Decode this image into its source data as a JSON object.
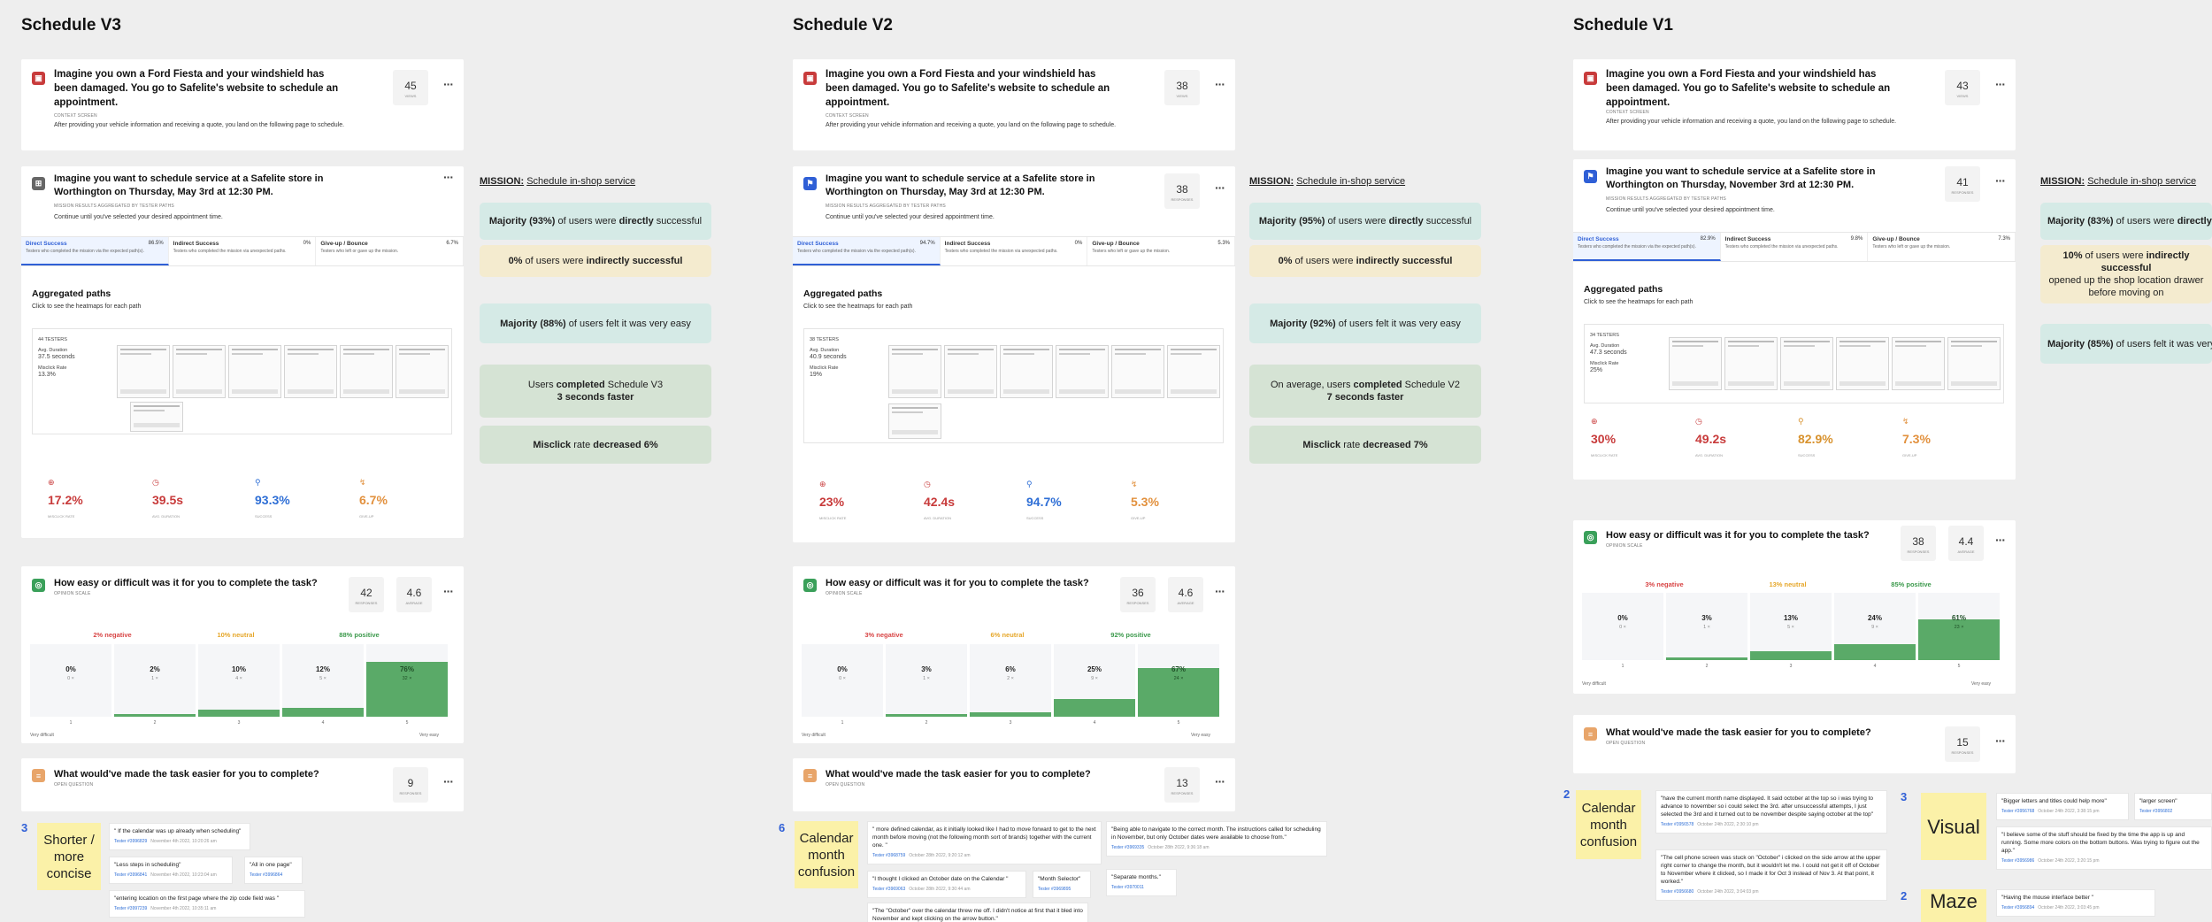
{
  "columns": [
    {
      "title": "Schedule V3",
      "context": {
        "title": "Imagine you own a Ford Fiesta and your windshield has been damaged. You go to Safelite's website to schedule an appointment.",
        "type": "CONTEXT SCREEN",
        "desc": "After providing your vehicle information and receiving a quote, you land on the following page to schedule.",
        "count": "45",
        "count_unit": "Views"
      },
      "mission": {
        "title": "Imagine you want to schedule service at a Safelite store in Worthington on Thursday, May 3rd at 12:30 PM.",
        "sub": "MISSION RESULTS AGGREGATED BY TESTER PATHS",
        "desc": "Continue until you've selected your desired appointment time.",
        "tabs": [
          {
            "label": "Direct Success",
            "pct": "86.5%",
            "desc": "Testers who completed the mission via the expected path(s).",
            "pct2": "40.5"
          },
          {
            "label": "Indirect Success",
            "pct": "0%",
            "desc": "Testers who completed the mission via unexpected paths.",
            "pct2": "0%"
          },
          {
            "label": "Give-up / Bounce",
            "pct": "6.7%",
            "desc": "Testers who left or gave up the mission.",
            "pct2": "3%"
          }
        ],
        "agg_title": "Aggregated paths",
        "agg_sub": "Click to see the heatmaps for each path",
        "stats": [
          "44 TESTERS",
          "Avg. Duration",
          "37.5 seconds",
          "Misclick Rate",
          "13.3%"
        ],
        "metrics": [
          {
            "icon": "⊕",
            "value": "17.2%",
            "label": "Misclick rate",
            "cls": "mc-red"
          },
          {
            "icon": "◷",
            "value": "39.5s",
            "label": "Avg. duration",
            "cls": "mc-red"
          },
          {
            "icon": "⚲",
            "value": "93.3%",
            "label": "Success",
            "cls": "mc-blue"
          },
          {
            "icon": "↯",
            "value": "6.7%",
            "label": "Give-up",
            "cls": "mc-peach"
          }
        ]
      },
      "difficulty": {
        "title": "How easy or difficult was it for you to complete the task?",
        "sub": "OPINION SCALE",
        "count": "42",
        "count_unit": "Responses",
        "avg": "4.6",
        "avg_unit": "Average",
        "neg": "2% negative",
        "neu": "10% neutral",
        "pos": "88% positive",
        "bars": [
          {
            "pct": "0%",
            "n": "0 ×",
            "fill": 0
          },
          {
            "pct": "2%",
            "n": "1 ×",
            "fill": 2
          },
          {
            "pct": "10%",
            "n": "4 ×",
            "fill": 10
          },
          {
            "pct": "12%",
            "n": "5 ×",
            "fill": 12
          },
          {
            "pct": "76%",
            "n": "32 ×",
            "fill": 76
          }
        ],
        "ticks": [
          "1",
          "2",
          "3",
          "4",
          "5"
        ],
        "axis_left": "Very difficult",
        "axis_right": "Very easy"
      },
      "easier": {
        "title": "What would've made the task easier for you to complete?",
        "sub": "OPEN QUESTION",
        "count": "9",
        "count_unit": "Responses"
      }
    },
    {
      "title": "Schedule V2",
      "context": {
        "title": "Imagine you own a Ford Fiesta and your windshield has been damaged. You go to Safelite's website to schedule an appointment.",
        "type": "CONTEXT SCREEN",
        "desc": "After providing your vehicle information and receiving a quote, you land on the following page to schedule.",
        "count": "38",
        "count_unit": "Views"
      },
      "mission": {
        "title": "Imagine you want to schedule service at a Safelite store in Worthington on Thursday, May 3rd at 12:30 PM.",
        "sub": "MISSION RESULTS AGGREGATED BY TESTER PATHS",
        "desc": "Continue until you've selected your desired appointment time.",
        "count": "38",
        "count_unit": "Responses",
        "tabs": [
          {
            "label": "Direct Success",
            "pct": "94.7%",
            "desc": "Testers who completed the mission via the expected path(s).",
            "pct2": "36 ×"
          },
          {
            "label": "Indirect Success",
            "pct": "0%",
            "desc": "Testers who completed the mission via unexpected paths.",
            "pct2": "0 ×"
          },
          {
            "label": "Give-up / Bounce",
            "pct": "5.3%",
            "desc": "Testers who left or gave up the mission.",
            "pct2": "2 ×"
          }
        ],
        "agg_title": "Aggregated paths",
        "agg_sub": "Click to see the heatmaps for each path",
        "stats": [
          "38 TESTERS",
          "Avg. Duration",
          "40.9 seconds",
          "Misclick Rate",
          "19%"
        ],
        "metrics": [
          {
            "icon": "⊕",
            "value": "23%",
            "label": "Misclick rate",
            "cls": "mc-red"
          },
          {
            "icon": "◷",
            "value": "42.4s",
            "label": "Avg. duration",
            "cls": "mc-red"
          },
          {
            "icon": "⚲",
            "value": "94.7%",
            "label": "Success",
            "cls": "mc-blue"
          },
          {
            "icon": "↯",
            "value": "5.3%",
            "label": "Give-up",
            "cls": "mc-peach"
          }
        ]
      },
      "difficulty": {
        "title": "How easy or difficult was it for you to complete the task?",
        "sub": "OPINION SCALE",
        "count": "36",
        "count_unit": "Responses",
        "avg": "4.6",
        "avg_unit": "Average",
        "neg": "3% negative",
        "neu": "6% neutral",
        "pos": "92% positive",
        "bars": [
          {
            "pct": "0%",
            "n": "0 ×",
            "fill": 0
          },
          {
            "pct": "3%",
            "n": "1 ×",
            "fill": 3
          },
          {
            "pct": "6%",
            "n": "2 ×",
            "fill": 6
          },
          {
            "pct": "25%",
            "n": "9 ×",
            "fill": 25
          },
          {
            "pct": "67%",
            "n": "24 ×",
            "fill": 67
          }
        ],
        "ticks": [
          "1",
          "2",
          "3",
          "4",
          "5"
        ],
        "axis_left": "Very difficult",
        "axis_right": "Very easy"
      },
      "easier": {
        "title": "What would've made the task easier for you to complete?",
        "sub": "OPEN QUESTION",
        "count": "13",
        "count_unit": "Responses"
      }
    },
    {
      "title": "Schedule V1",
      "context": {
        "title": "Imagine you own a Ford Fiesta and your windshield has been damaged. You go to Safelite's website to schedule an appointment.",
        "type": "CONTEXT SCREEN",
        "desc": "After providing your vehicle information and receiving a quote, you land on the following page to schedule.",
        "count": "43",
        "count_unit": "Views"
      },
      "mission": {
        "title": "Imagine you want to schedule service at a Safelite store in Worthington on Thursday, November 3rd at 12:30 PM.",
        "sub": "MISSION RESULTS AGGREGATED BY TESTER PATHS",
        "desc": "Continue until you've selected your desired appointment time.",
        "count": "41",
        "count_unit": "Responses",
        "tabs": [
          {
            "label": "Direct Success",
            "pct": "82.9%",
            "desc": "Testers who completed the mission via the expected path(s).",
            "pct2": "34 ×"
          },
          {
            "label": "Indirect Success",
            "pct": "9.8%",
            "desc": "Testers who completed the mission via unexpected paths.",
            "pct2": "4 ×"
          },
          {
            "label": "Give-up / Bounce",
            "pct": "7.3%",
            "desc": "Testers who left or gave up the mission.",
            "pct2": "3 ×"
          }
        ],
        "agg_title": "Aggregated paths",
        "agg_sub": "Click to see the heatmaps for each path",
        "stats": [
          "34 TESTERS",
          "Avg. Duration",
          "47.3 seconds",
          "Misclick Rate",
          "25%"
        ],
        "metrics": [
          {
            "icon": "⊕",
            "value": "30%",
            "label": "Misclick rate",
            "cls": "mc-red"
          },
          {
            "icon": "◷",
            "value": "49.2s",
            "label": "Avg. duration",
            "cls": "mc-red"
          },
          {
            "icon": "⚲",
            "value": "82.9%",
            "label": "Success",
            "cls": "mc-orange"
          },
          {
            "icon": "↯",
            "value": "7.3%",
            "label": "Give-up",
            "cls": "mc-peach"
          }
        ]
      },
      "difficulty": {
        "title": "How easy or difficult was it for you to complete the task?",
        "sub": "OPINION SCALE",
        "count": "38",
        "count_unit": "Responses",
        "avg": "4.4",
        "avg_unit": "Average",
        "neg": "3% negative",
        "neu": "13% neutral",
        "pos": "85% positive",
        "bars": [
          {
            "pct": "0%",
            "n": "0 ×",
            "fill": 0
          },
          {
            "pct": "3%",
            "n": "1 ×",
            "fill": 3
          },
          {
            "pct": "13%",
            "n": "5 ×",
            "fill": 13
          },
          {
            "pct": "24%",
            "n": "9 ×",
            "fill": 24
          },
          {
            "pct": "61%",
            "n": "23 ×",
            "fill": 61
          }
        ],
        "ticks": [
          "1",
          "2",
          "3",
          "4",
          "5"
        ],
        "axis_left": "Very difficult",
        "axis_right": "Very easy"
      },
      "easier": {
        "title": "What would've made the task easier for you to complete?",
        "sub": "OPEN QUESTION",
        "count": "15",
        "count_unit": "Responses"
      }
    }
  ],
  "missions": [
    {
      "heading_bold": "MISSION:",
      "heading_link": "Schedule in-shop service",
      "c1": [
        "Majority (93%)",
        " of users were ",
        "directly",
        " successful"
      ],
      "c2": [
        "0%",
        " of users were ",
        "indirectly successful",
        ""
      ],
      "c3": [
        "Majority (88%)",
        " of users felt it was very easy"
      ],
      "c4": [
        "Users ",
        "completed",
        " Schedule V3",
        "3 seconds faster"
      ],
      "c5": [
        "Misclick",
        " rate ",
        "decreased 6%"
      ]
    },
    {
      "heading_bold": "MISSION:",
      "heading_link": "Schedule in-shop service",
      "c1": [
        "Majority (95%)",
        " of users were ",
        "directly",
        " successful"
      ],
      "c2": [
        "0%",
        " of users were ",
        "indirectly successful",
        ""
      ],
      "c3": [
        "Majority (92%)",
        " of users felt it was very easy"
      ],
      "c4": [
        "On average, users ",
        "completed",
        " Schedule V2",
        "7 seconds faster"
      ],
      "c5": [
        "Misclick",
        " rate ",
        "decreased 7%"
      ]
    },
    {
      "heading_bold": "MISSION:",
      "heading_link": "Schedule in-shop service",
      "c1": [
        "Majority (83%)",
        " of users were ",
        "directly",
        " successful"
      ],
      "c2": [
        "10%",
        " of users were ",
        "indirectly successful",
        " opened up the shop location drawer before moving on"
      ],
      "c3": [
        "Majority (85%)",
        " of users felt it was very easy"
      ]
    }
  ],
  "stickies": [
    {
      "count": "3",
      "text": "Shorter / more concise"
    },
    {
      "count": "6",
      "text": "Calendar month confusion"
    },
    {
      "count": "2",
      "text": "Calendar month confusion"
    },
    {
      "count": "3",
      "text": "Visual"
    },
    {
      "count": "2",
      "text": "Maze"
    }
  ],
  "quotes": {
    "v3": [
      {
        "text": "\" If the calendar was up already when scheduling\"",
        "tester": "Tester #3996829",
        "date": "November 4th 2022, 10:20:26 am"
      },
      {
        "text": "\"Less steps in scheduling\"",
        "tester": "Tester #3996841",
        "date": "November 4th 2022, 10:23:04 am"
      },
      {
        "text": "\"All in one page\"",
        "tester": "Tester #3996864",
        "date": ""
      },
      {
        "text": "\"entering location on the first page where the zip code field was \"",
        "tester": "Tester #3997239",
        "date": "November 4th 2022, 10:35:11 am"
      }
    ],
    "v2": [
      {
        "text": "\" more defined calendar, as it initially looked like I had to move forward to get to the next month before moving (not the following month sort of brands) together with the current one. \"",
        "tester": "Tester #3968759",
        "date": "October 28th 2022, 9:20:12 am"
      },
      {
        "text": "\"Being able to navigate to the correct month. The instructions called for scheduling in November, but only October dates were available to choose from.\"",
        "tester": "Tester #3969335",
        "date": "October 28th 2022, 9:36:18 am"
      },
      {
        "text": "\"I thought I clicked an October date on the Calendar \"",
        "tester": "Tester #3969063",
        "date": "October 28th 2022, 9:30:44 am"
      },
      {
        "text": "\"Month Selector\"",
        "tester": "Tester #3969895",
        "date": ""
      },
      {
        "text": "\"Separate months.\"",
        "tester": "Tester #3970011",
        "date": ""
      },
      {
        "text": "\"The \"October\" over the calendar threw me off. I didn't notice at first that it bled into November and kept clicking on the arrow button.\"",
        "tester": "Tester #3970210",
        "date": ""
      }
    ],
    "v1": [
      {
        "text": "\"have the current month name displayed. It said october at the top so i was trying to advance to november so i could select the 3rd. after unsuccessful attempts, I just selected the 3rd and it turned out to be november despite saying october at the top\"",
        "tester": "Tester #3956578",
        "date": "October 24th 2022, 2:30:10 pm"
      },
      {
        "text": "\"The cell phone screen was stuck on \"October\" i clicked on the side arrow at the upper right corner to change the month, but it wouldn't let me. I could not get it off of October to November where it clicked, so I made it for Oct 3 instead of Nov 3. At that point, it worked.\"",
        "tester": "Tester #3956680",
        "date": "October 24th 2022, 3:04:03 pm"
      },
      {
        "text": "\"Bigger letters and titles could help more\"",
        "tester": "Tester #3956768",
        "date": "October 24th 2022, 3:38:15 pm"
      },
      {
        "text": "\"larger screen\"",
        "tester": "Tester #3956802",
        "date": ""
      },
      {
        "text": "\"I believe some of the stuff should be fixed by the time the app is up and running. Some more colors on the bottom buttons. Was trying to figure out the app.\"",
        "tester": "Tester #3956986",
        "date": "October 24th 2022, 3:20:15 pm"
      },
      {
        "text": "\"Having the mouse interface better \"",
        "tester": "Tester #3956894",
        "date": "October 24th 2022, 3:03:45 pm"
      }
    ]
  },
  "colors": {
    "accent": "#2f5fd6",
    "positive": "#5aaa68",
    "negative": "#d84545",
    "neutral": "#e6a72a",
    "sticky": "#fbf1a8"
  }
}
